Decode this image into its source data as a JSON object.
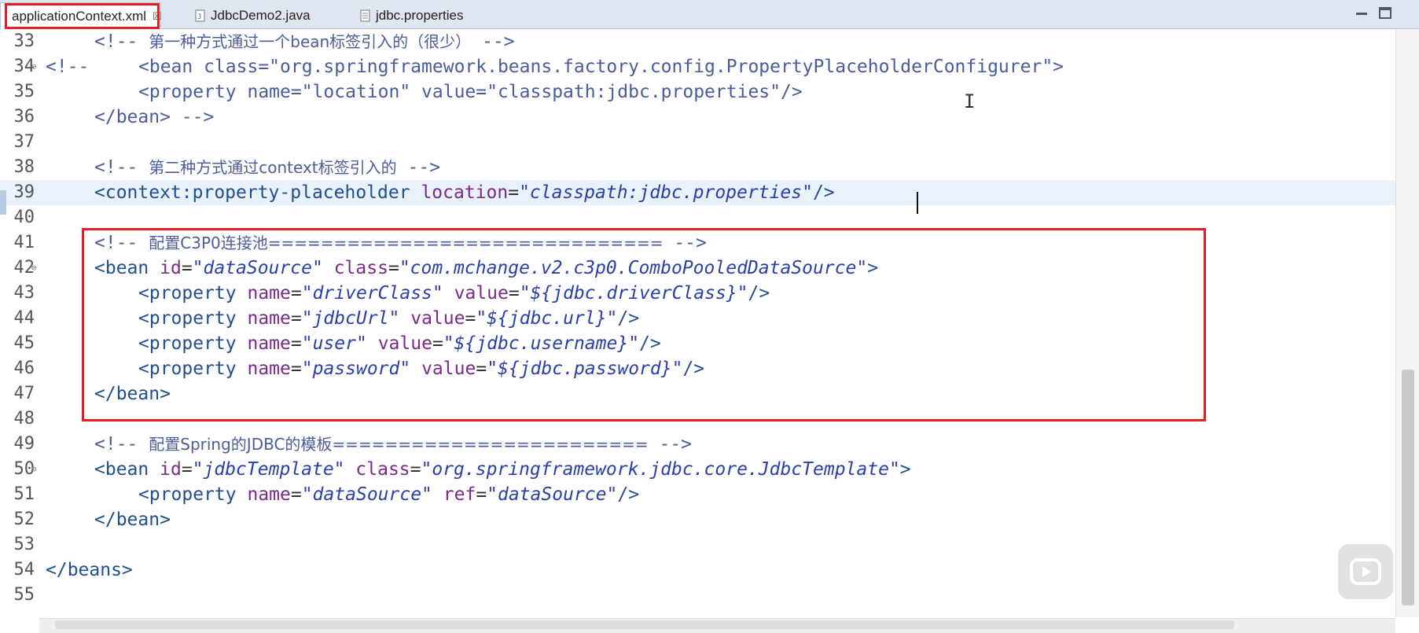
{
  "tabs": [
    {
      "label": "applicationContext.xml",
      "active": true,
      "icon": "xml-file-icon",
      "close": "☒"
    },
    {
      "label": "JdbcDemo2.java",
      "active": false,
      "icon": "java-file-icon"
    },
    {
      "label": "jdbc.properties",
      "active": false,
      "icon": "properties-file-icon"
    }
  ],
  "editor": {
    "lines": [
      {
        "num": "33"
      },
      {
        "num": "34",
        "fold": "⊖"
      },
      {
        "num": "35"
      },
      {
        "num": "36"
      },
      {
        "num": "37"
      },
      {
        "num": "38"
      },
      {
        "num": "39",
        "current": true
      },
      {
        "num": "40"
      },
      {
        "num": "41"
      },
      {
        "num": "42",
        "fold": "⊖"
      },
      {
        "num": "43"
      },
      {
        "num": "44"
      },
      {
        "num": "45"
      },
      {
        "num": "46"
      },
      {
        "num": "47"
      },
      {
        "num": "48"
      },
      {
        "num": "49"
      },
      {
        "num": "50",
        "fold": "⊖"
      },
      {
        "num": "51"
      },
      {
        "num": "52"
      },
      {
        "num": "53"
      },
      {
        "num": "54"
      },
      {
        "num": "55"
      }
    ],
    "code": {
      "l33_c": "第一种方式通过一个bean标签引入的（很少）",
      "l34_a": "<!--",
      "l34_b": "<bean class=\"org.springframework.beans.factory.config.PropertyPlaceholderConfigurer\">",
      "l35": "<property name=\"location\" value=\"classpath:jdbc.properties\"/>",
      "l36": "</bean> -->",
      "l38_c": "第二种方式通过context标签引入的",
      "l39_tag": "<context:property-placeholder",
      "l39_attr": "location",
      "l39_val": "\"classpath:jdbc.properties\"",
      "l39_end": "/>",
      "l41_c": "配置C3P0连接池==============================",
      "l42_tag": "<bean",
      "l42_attr1": "id",
      "l42_val1": "\"dataSource\"",
      "l42_attr2": "class",
      "l42_val2": "\"com.mchange.v2.c3p0.ComboPooledDataSource\"",
      "l43_name": "\"driverClass\"",
      "l43_value": "\"${jdbc.driverClass}\"",
      "l44_name": "\"jdbcUrl\"",
      "l44_value": "\"${jdbc.url}\"",
      "l45_name": "\"user\"",
      "l45_value": "\"${jdbc.username}\"",
      "l46_name": "\"password\"",
      "l46_value": "\"${jdbc.password}\"",
      "l47": "</bean>",
      "l49_c": "配置Spring的JDBC的模板========================",
      "l50_val1": "\"jdbcTemplate\"",
      "l50_val2": "\"org.springframework.jdbc.core.JdbcTemplate\"",
      "l51_name": "\"dataSource\"",
      "l51_ref": "\"dataSource\"",
      "l52": "</bean>",
      "l54": "</beans>"
    },
    "tokens": {
      "comment_open": "<!--",
      "comment_close": "-->",
      "property_tag": "<property",
      "name_attr": "name",
      "value_attr": "value",
      "ref_attr": "ref",
      "self_close": "\"/>",
      "bean_close": "\">",
      "class_attr": "class",
      "id_attr": "id",
      "equals": "=",
      "bean_tag": "<bean"
    }
  },
  "colors": {
    "highlight_box": "#e51d24",
    "current_line": "#e9f2fb",
    "comment": "#4b5c9a",
    "tag": "#1f4f8f",
    "attribute": "#7a2a8a",
    "string": "#2a3fa8"
  }
}
